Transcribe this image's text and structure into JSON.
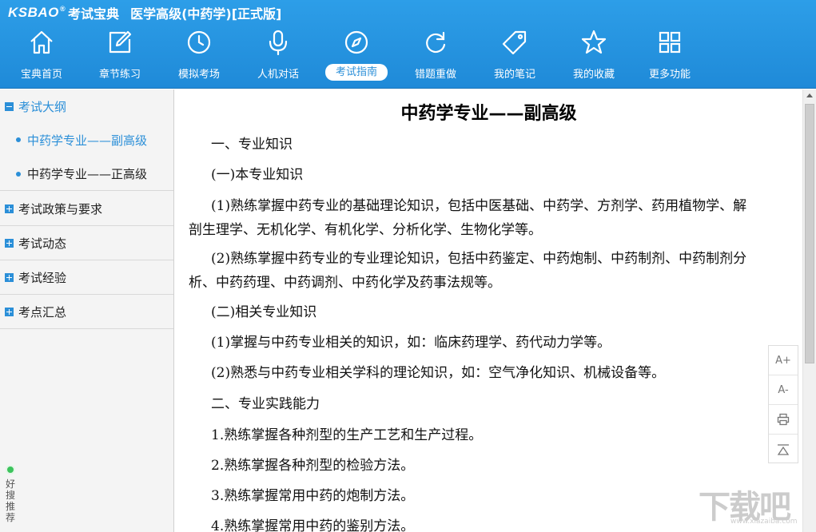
{
  "app": {
    "brand": "KSBAO",
    "brand_mark": "®",
    "brand_cn": "考试宝典",
    "title": "医学高级(中药学)[正式版]"
  },
  "nav": {
    "items": [
      {
        "label": "宝典首页",
        "icon": "home-icon"
      },
      {
        "label": "章节练习",
        "icon": "edit-icon"
      },
      {
        "label": "模拟考场",
        "icon": "clock-icon"
      },
      {
        "label": "人机对话",
        "icon": "microphone-icon"
      },
      {
        "label": "考试指南",
        "icon": "compass-icon",
        "active": true
      },
      {
        "label": "错题重做",
        "icon": "refresh-icon"
      },
      {
        "label": "我的笔记",
        "icon": "tag-icon"
      },
      {
        "label": "我的收藏",
        "icon": "star-icon"
      },
      {
        "label": "更多功能",
        "icon": "grid-icon"
      }
    ]
  },
  "sidebar": {
    "groups": [
      {
        "label": "考试大纲",
        "expanded": true,
        "children": [
          "中药学专业——副高级",
          "中药学专业——正高级"
        ]
      },
      {
        "label": "考试政策与要求",
        "expanded": false
      },
      {
        "label": "考试动态",
        "expanded": false
      },
      {
        "label": "考试经验",
        "expanded": false
      },
      {
        "label": "考点汇总",
        "expanded": false
      }
    ],
    "recommend": [
      "好",
      "搜",
      "推",
      "荐"
    ]
  },
  "document": {
    "title": "中药学专业——副高级",
    "paragraphs": [
      "一、专业知识",
      "(一)本专业知识",
      "(1)熟练掌握中药专业的基础理论知识，包括中医基础、中药学、方剂学、药用植物学、解剖生理学、无机化学、有机化学、分析化学、生物化学等。",
      "(2)熟练掌握中药专业的专业理论知识，包括中药鉴定、中药炮制、中药制剂、中药制剂分析、中药药理、中药调剂、中药化学及药事法规等。",
      "(二)相关专业知识",
      "(1)掌握与中药专业相关的知识，如：临床药理学、药代动力学等。",
      "(2)熟悉与中药专业相关学科的理论知识，如：空气净化知识、机械设备等。",
      "二、专业实践能力",
      "1.熟练掌握各种剂型的生产工艺和生产过程。",
      "2.熟练掌握各种剂型的检验方法。",
      "3.熟练掌握常用中药的炮制方法。",
      "4.熟练掌握常用中药的鉴别方法。"
    ]
  },
  "tools": {
    "font_increase": "A+",
    "font_decrease": "A-"
  },
  "watermark": {
    "text": "下载吧",
    "url": "www.xiazaiba.com"
  },
  "colors": {
    "header_blue": "#2d9ee8",
    "accent": "#2b8fd8",
    "recommend_green": "#3cc35c"
  }
}
